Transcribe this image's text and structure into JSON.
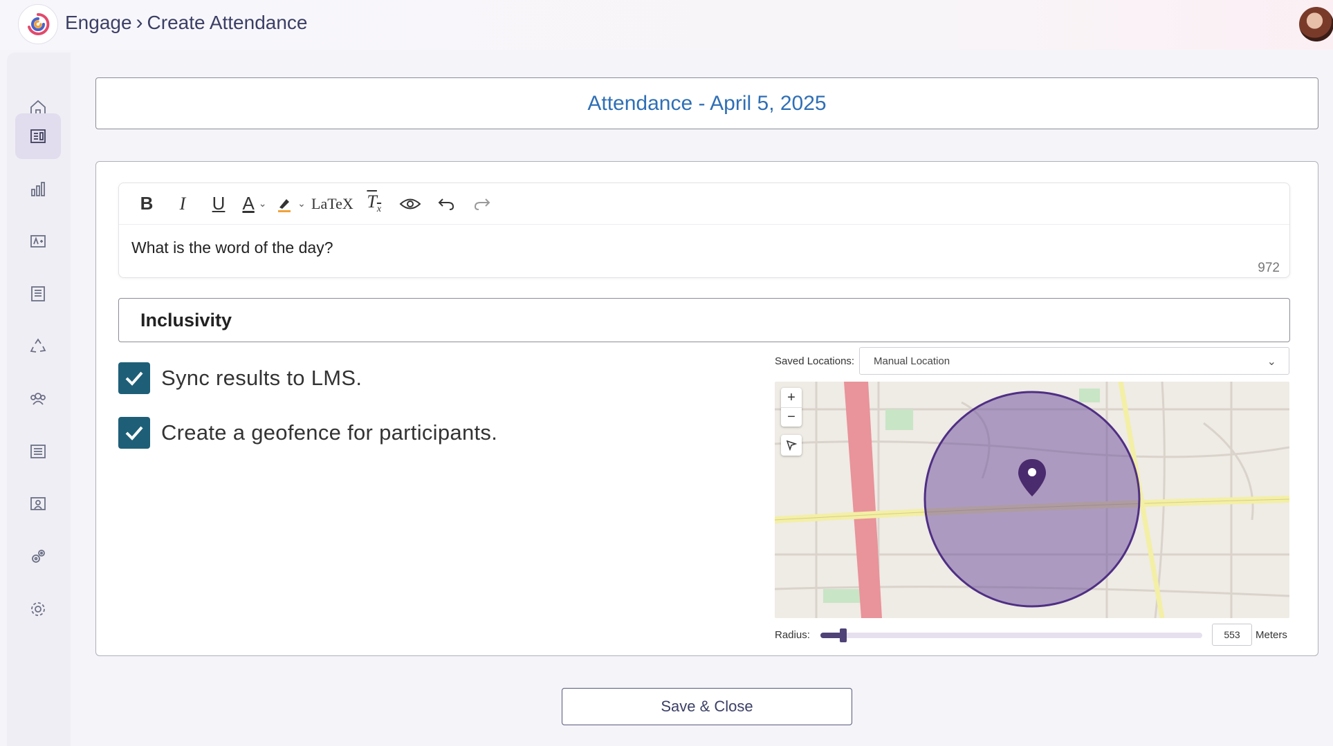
{
  "header": {
    "breadcrumb": [
      "Engage",
      "Create Attendance"
    ]
  },
  "sidebar": {
    "items": [
      {
        "icon": "home-icon"
      },
      {
        "icon": "dashboard-icon",
        "active": true
      },
      {
        "icon": "bar-chart-icon"
      },
      {
        "icon": "grade-icon"
      },
      {
        "icon": "document-icon"
      },
      {
        "icon": "recycle-icon"
      },
      {
        "icon": "people-icon"
      },
      {
        "icon": "list-icon"
      },
      {
        "icon": "presentation-icon"
      },
      {
        "icon": "integrations-icon"
      },
      {
        "icon": "settings-icon"
      }
    ]
  },
  "main": {
    "title": "Attendance - April 5, 2025",
    "editor": {
      "toolbar": [
        "bold",
        "italic",
        "underline",
        "text-color",
        "highlight",
        "latex",
        "clear-format",
        "preview",
        "undo",
        "redo"
      ],
      "latex_label": "LaTeX",
      "content": "What is the word of the day?",
      "char_count": "972"
    },
    "answer": "Inclusivity",
    "options": [
      {
        "label": "Sync results to LMS.",
        "checked": true
      },
      {
        "label": "Create a geofence for participants.",
        "checked": true
      }
    ],
    "location": {
      "saved_label": "Saved Locations:",
      "selected": "Manual Location",
      "radius_label": "Radius:",
      "radius_value": "553",
      "radius_unit": "Meters",
      "radius_fraction": 0.06
    },
    "save_button": "Save & Close"
  },
  "colors": {
    "accent": "#2f6fb5",
    "checkbox": "#1e5f77",
    "slider": "#4f4277",
    "geofence": "#6a4a9c"
  }
}
